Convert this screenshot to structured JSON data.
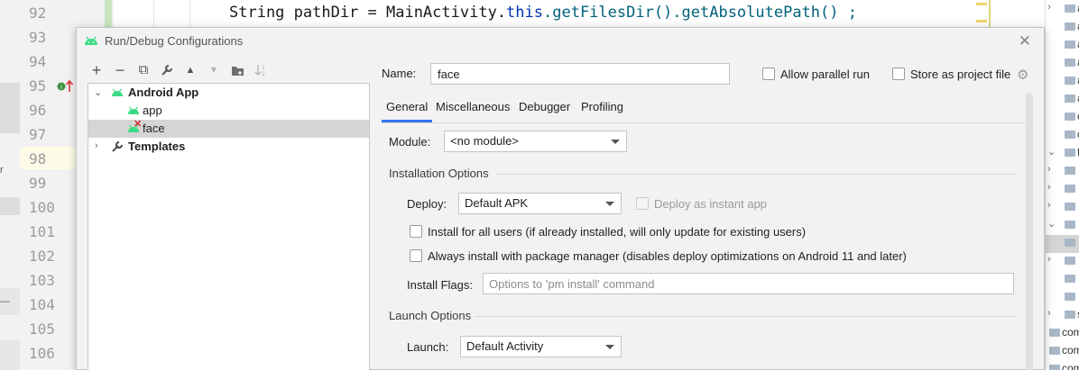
{
  "editor": {
    "line_numbers": [
      "92",
      "93",
      "94",
      "95",
      "96",
      "97",
      "98",
      "99",
      "100",
      "101",
      "102",
      "103",
      "104",
      "105",
      "106"
    ],
    "code_line": {
      "part1": "String pathDir = MainActivity.",
      "keyword": "this",
      "part2": ".getFilesDir().getAbsolutePath() ;"
    },
    "left_marks": [
      "r",
      "—"
    ],
    "right_panel_rows": [
      {
        "chevron": "›",
        "text": "a"
      },
      {
        "chevron": "",
        "text": "a"
      },
      {
        "chevron": "",
        "text": "a"
      },
      {
        "chevron": "",
        "text": "a"
      },
      {
        "chevron": "",
        "text": "a"
      },
      {
        "chevron": "",
        "text": "a"
      },
      {
        "chevron": "",
        "text": "c"
      },
      {
        "chevron": "",
        "text": "c"
      },
      {
        "chevron": "⌄",
        "text": "f"
      },
      {
        "chevron": "›",
        "text": ""
      },
      {
        "chevron": "›",
        "text": ""
      },
      {
        "chevron": "›",
        "text": ""
      },
      {
        "chevron": "⌄",
        "text": ""
      },
      {
        "chevron": "",
        "text": ""
      },
      {
        "chevron": "›",
        "text": ""
      },
      {
        "chevron": "",
        "text": ""
      },
      {
        "chevron": "",
        "text": ""
      },
      {
        "chevron": "›",
        "text": "s"
      },
      {
        "chevron": "",
        "text": "com"
      },
      {
        "chevron": "",
        "text": "com"
      },
      {
        "chevron": "",
        "text": "com"
      }
    ]
  },
  "dialog": {
    "title": "Run/Debug Configurations",
    "close_glyph": "✕",
    "toolbar": [
      {
        "name": "add-config-button",
        "glyph": "+",
        "enabled": true
      },
      {
        "name": "remove-config-button",
        "glyph": "−",
        "enabled": true
      },
      {
        "name": "copy-config-button",
        "glyph": "⧉",
        "enabled": true
      },
      {
        "name": "edit-templates-button",
        "glyph": "🔧",
        "enabled": true
      },
      {
        "name": "move-up-button",
        "glyph": "▲",
        "enabled": true
      },
      {
        "name": "move-down-button",
        "glyph": "▼",
        "enabled": false
      },
      {
        "name": "new-folder-button",
        "glyph": "▣",
        "enabled": true
      },
      {
        "name": "sort-button",
        "glyph": "↓",
        "enabled": false
      }
    ],
    "tree": {
      "android_app": "Android App",
      "app": "app",
      "face": "face",
      "templates": "Templates"
    },
    "name_label": "Name:",
    "name_value": "face",
    "allow_parallel_run": "Allow parallel run",
    "store_as_project_file": "Store as project file",
    "tabs": [
      "General",
      "Miscellaneous",
      "Debugger",
      "Profiling"
    ],
    "module_label": "Module:",
    "module_value": "<no module>",
    "installation_options": "Installation Options",
    "deploy_label": "Deploy:",
    "deploy_value": "Default APK",
    "deploy_instant": "Deploy as instant app",
    "install_all_users": "Install for all users (if already installed, will only update for existing users)",
    "always_install_pm": "Always install with package manager (disables deploy optimizations on Android 11 and later)",
    "install_flags_label": "Install Flags:",
    "install_flags_placeholder": "Options to 'pm install' command",
    "launch_options": "Launch Options",
    "launch_label": "Launch:",
    "launch_value": "Default Activity"
  },
  "colors": {
    "accent": "#3574f0",
    "android_green": "#3ddc84",
    "error_red": "#d62d2d"
  }
}
